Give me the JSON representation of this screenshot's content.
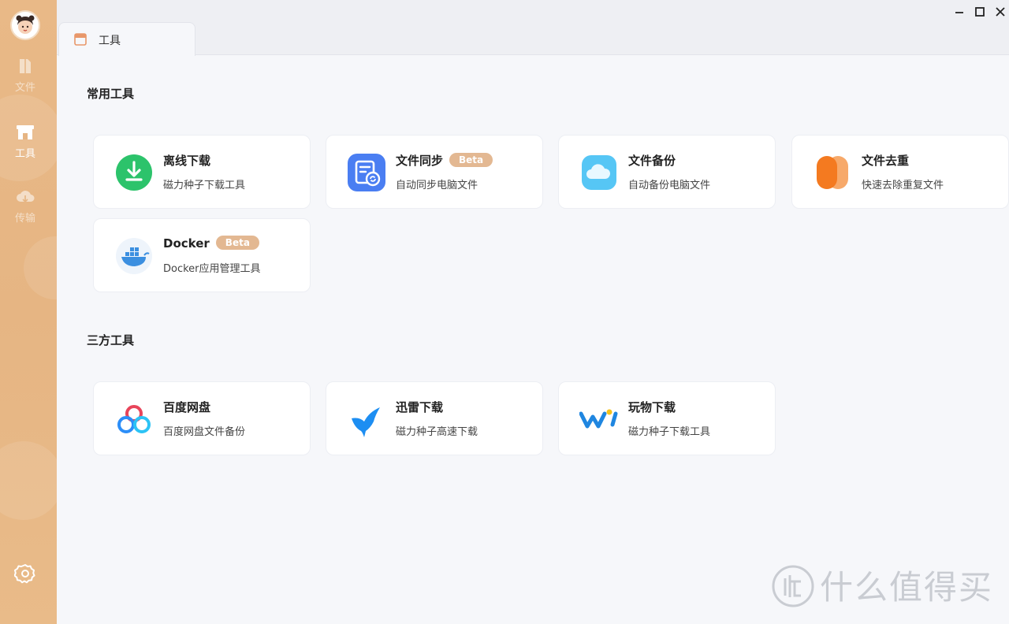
{
  "sidebar": {
    "items": [
      {
        "label": "文件",
        "icon": "file-icon",
        "active": false
      },
      {
        "label": "工具",
        "icon": "store-icon",
        "active": true
      },
      {
        "label": "传输",
        "icon": "cloud-transfer-icon",
        "active": false
      }
    ],
    "settings_icon": "gear-icon",
    "accent": "#e6b583"
  },
  "tabs": [
    {
      "label": "工具",
      "icon": "store-icon"
    }
  ],
  "sections": {
    "common": {
      "title": "常用工具",
      "cards": [
        {
          "title": "离线下载",
          "desc": "磁力种子下载工具",
          "icon": "download-icon"
        },
        {
          "title": "文件同步",
          "badge": "Beta",
          "desc": "自动同步电脑文件",
          "icon": "file-sync-icon"
        },
        {
          "title": "文件备份",
          "desc": "自动备份电脑文件",
          "icon": "cloud-icon"
        },
        {
          "title": "文件去重",
          "desc": "快速去除重复文件",
          "icon": "dedupe-icon"
        },
        {
          "title": "Docker",
          "badge": "Beta",
          "desc": "Docker应用管理工具",
          "icon": "docker-icon"
        }
      ]
    },
    "third_party": {
      "title": "三方工具",
      "cards": [
        {
          "title": "百度网盘",
          "desc": "百度网盘文件备份",
          "icon": "baidu-netdisk-icon"
        },
        {
          "title": "迅雷下载",
          "desc": "磁力种子高速下载",
          "icon": "xunlei-bird-icon"
        },
        {
          "title": "玩物下载",
          "desc": "磁力种子下载工具",
          "icon": "wanwu-icon"
        }
      ]
    }
  },
  "watermark": "什么值得买",
  "colors": {
    "badge": "#e3b892",
    "download_green": "#2cc36b",
    "sync_blue": "#4a7ef2",
    "backup_blue": "#56c6f5",
    "dedupe_orange": "#f47a20"
  }
}
